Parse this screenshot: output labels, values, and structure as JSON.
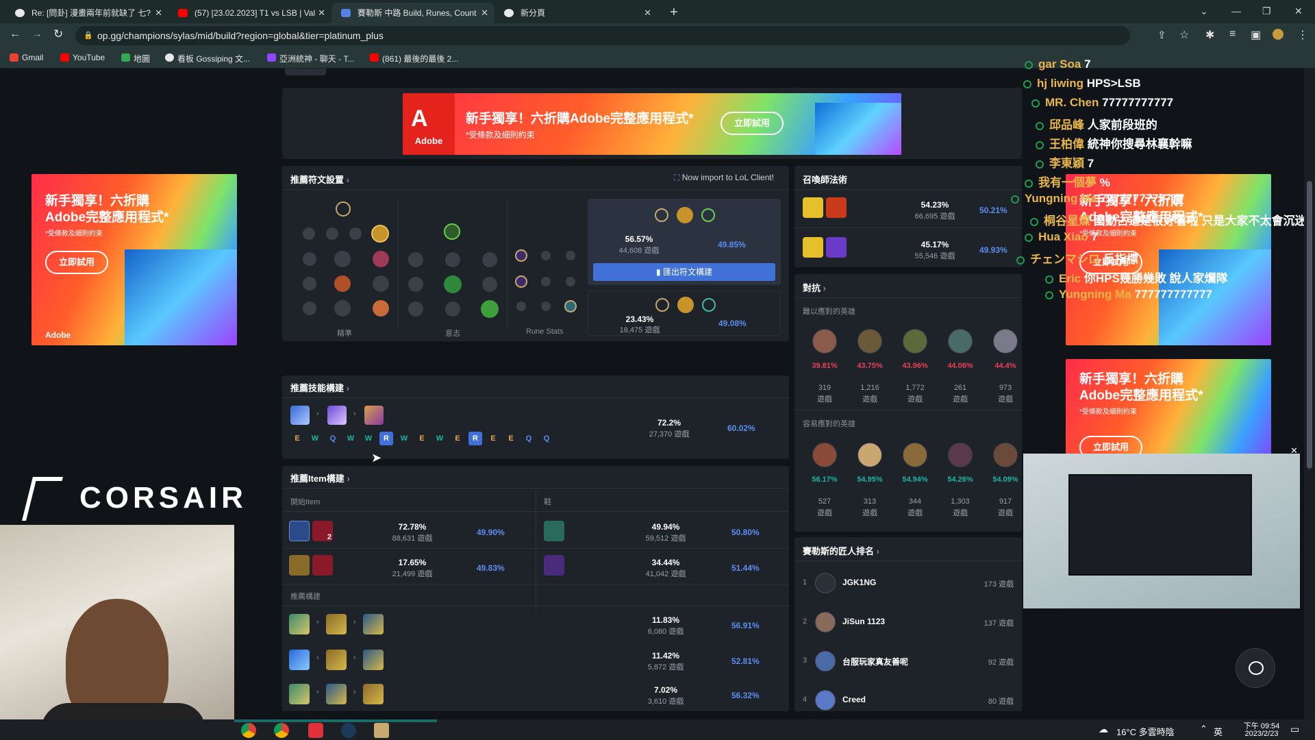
{
  "browser": {
    "tabs": [
      {
        "label": "Re: [問卦] 漫畫兩年前就缺了 七?",
        "active": false
      },
      {
        "label": "(57) [23.02.2023] T1 vs LSB | Val",
        "active": false
      },
      {
        "label": "賽勒斯 中路 Build, Runes, Count",
        "active": true
      },
      {
        "label": "新分頁",
        "active": false
      }
    ],
    "new_tab": "+",
    "url": "op.gg/champions/sylas/mid/build?region=global&tier=platinum_plus",
    "bookmarks": [
      "Gmail",
      "YouTube",
      "地圖",
      "看板 Gossiping 文...",
      "亞洲統神 - 聊天 - T...",
      "(861) 最後的最後 2..."
    ]
  },
  "ads": {
    "headline": "新手獨享！六折購Adobe完整應用程式*",
    "headline_short_1": "新手獨享！六折購",
    "headline_short_2": "Adobe完整應用程式*",
    "disclaimer": "*受條款及細則約束",
    "cta": "立即試用",
    "brand": "Adobe"
  },
  "corsair": "CORSAIR",
  "runes": {
    "title": "推薦符文設置",
    "import_label": "Now import to LoL Client!",
    "tree1_label": "精準",
    "tree2_label": "意志",
    "stats_label": "Rune Stats",
    "export_button": "匯出符文構建",
    "options": [
      {
        "pick": "56.57%",
        "games": "44,608 遊戲",
        "win": "49.85%"
      },
      {
        "pick": "23.43%",
        "games": "18,475 遊戲",
        "win": "49.08%"
      }
    ]
  },
  "spells": {
    "title": "召喚師法術",
    "rows": [
      {
        "pick": "54.23%",
        "games": "66,695 遊戲",
        "win": "50.21%"
      },
      {
        "pick": "45.17%",
        "games": "55,546 遊戲",
        "win": "49.93%"
      }
    ]
  },
  "skills": {
    "title": "推薦技能構建",
    "order": [
      "E",
      "W",
      "Q",
      "W",
      "W",
      "R",
      "W",
      "E",
      "W",
      "E",
      "R",
      "E",
      "E",
      "Q",
      "Q"
    ],
    "pick": "72.2%",
    "games": "27,370 遊戲",
    "win": "60.02%"
  },
  "items": {
    "title": "推薦Item構建",
    "start_label": "開始Item",
    "boots_label": "鞋",
    "build_label": "推薦構建",
    "start": [
      {
        "count": "2",
        "pick": "72.78%",
        "games": "88,631 遊戲",
        "win": "49.90%"
      },
      {
        "count": "",
        "pick": "17.65%",
        "games": "21,499 遊戲",
        "win": "49.83%"
      }
    ],
    "boots": [
      {
        "pick": "49.94%",
        "games": "59,512 遊戲",
        "win": "50.80%"
      },
      {
        "pick": "34.44%",
        "games": "41,042 遊戲",
        "win": "51.44%"
      }
    ],
    "core": [
      {
        "pick": "11.83%",
        "games": "6,080 遊戲",
        "win": "56.91%"
      },
      {
        "pick": "11.42%",
        "games": "5,872 遊戲",
        "win": "52.81%"
      },
      {
        "pick": "7.02%",
        "games": "3,610 遊戲",
        "win": "56.32%"
      }
    ]
  },
  "counters": {
    "title": "對抗",
    "hard_label": "難以應對的英雄",
    "easy_label": "容易應對的英雄",
    "hard": [
      {
        "wr": "39.81%",
        "games": "319",
        "unit": "遊戲"
      },
      {
        "wr": "43.75%",
        "games": "1,216",
        "unit": "遊戲"
      },
      {
        "wr": "43.96%",
        "games": "1,772",
        "unit": "遊戲"
      },
      {
        "wr": "44.06%",
        "games": "261",
        "unit": "遊戲"
      },
      {
        "wr": "44.4%",
        "games": "973",
        "unit": "遊戲"
      }
    ],
    "easy": [
      {
        "wr": "56.17%",
        "games": "527",
        "unit": "遊戲"
      },
      {
        "wr": "54.95%",
        "games": "313",
        "unit": "遊戲"
      },
      {
        "wr": "54.94%",
        "games": "344",
        "unit": "遊戲"
      },
      {
        "wr": "54.26%",
        "games": "1,303",
        "unit": "遊戲"
      },
      {
        "wr": "54.09%",
        "games": "917",
        "unit": "遊戲"
      }
    ]
  },
  "masters": {
    "title": "賽勒斯的匠人排名",
    "rows": [
      {
        "rank": "1",
        "name": "JGK1NG",
        "games": "173 遊戲"
      },
      {
        "rank": "2",
        "name": "JiSun 1123",
        "games": "137 遊戲"
      },
      {
        "rank": "3",
        "name": "台服玩家真友善呢",
        "games": "92 遊戲"
      },
      {
        "rank": "4",
        "name": "Creed",
        "games": "80 遊戲"
      }
    ]
  },
  "chat": [
    {
      "name": "gar Soa",
      "msg": "7"
    },
    {
      "name": "hj liwing",
      "msg": "HPS>LSB"
    },
    {
      "name": "MR. Chen",
      "msg": "77777777777"
    },
    {
      "name": "邱品峰",
      "msg": "人家前段班的"
    },
    {
      "name": "王柏偉",
      "msg": "統神你搜尋林襄幹嘛"
    },
    {
      "name": "李東穎",
      "msg": "7"
    },
    {
      "name": "我有一個夢",
      "msg": "%"
    },
    {
      "name": "Yungning Ma",
      "msg": "7777777777777"
    },
    {
      "name": "桐谷星燦",
      "msg": "國動占道是很好看啦 只是大家不太會沉迷網路了"
    },
    {
      "name": "Hua Xiao",
      "msg": "7"
    },
    {
      "name": "チェンマシロ",
      "msg": "反指標"
    },
    {
      "name": "Eric",
      "msg": "你HPS幾勝幾敗 說人家爛隊"
    },
    {
      "name": "Yungning Ma",
      "msg": "777777777777"
    }
  ],
  "taskbar": {
    "weather": "16°C 多雲時陰",
    "ime": "英",
    "time": "下午 09:54",
    "date": "2023/2/23"
  },
  "colors": {
    "accent": "#5383e8",
    "red": "#e84057",
    "teal": "#19b5a8",
    "panel": "#1e2229"
  }
}
